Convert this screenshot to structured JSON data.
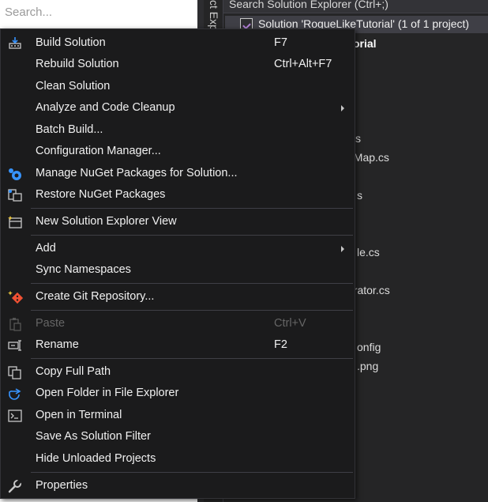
{
  "left_panel": {
    "search_placeholder": "Search..."
  },
  "side_tab": {
    "label": "ct Exp"
  },
  "solution_explorer": {
    "search_label": "Search Solution Explorer (Ctrl+;)",
    "solution_label": "Solution 'RogueLikeTutorial' (1 of 1 project)",
    "items": [
      "orial",
      "s",
      "nMap.cs",
      "s",
      "le.cs",
      "erator.cs",
      "onfig",
      ".png"
    ]
  },
  "context_menu": {
    "items": [
      {
        "label": "Build Solution",
        "shortcut": "F7",
        "icon": "build-icon"
      },
      {
        "label": "Rebuild Solution",
        "shortcut": "Ctrl+Alt+F7",
        "icon": ""
      },
      {
        "label": "Clean Solution",
        "shortcut": "",
        "icon": ""
      },
      {
        "label": "Analyze and Code Cleanup",
        "shortcut": "",
        "icon": "",
        "submenu": true
      },
      {
        "label": "Batch Build...",
        "shortcut": "",
        "icon": ""
      },
      {
        "label": "Configuration Manager...",
        "shortcut": "",
        "icon": ""
      },
      {
        "label": "Manage NuGet Packages for Solution...",
        "shortcut": "",
        "icon": "nuget-icon"
      },
      {
        "label": "Restore NuGet Packages",
        "shortcut": "",
        "icon": "restore-packages-icon"
      },
      {
        "label": "New Solution Explorer View",
        "shortcut": "",
        "icon": "new-view-icon"
      },
      {
        "label": "Add",
        "shortcut": "",
        "icon": "",
        "submenu": true
      },
      {
        "label": "Sync Namespaces",
        "shortcut": "",
        "icon": ""
      },
      {
        "label": "Create Git Repository...",
        "shortcut": "",
        "icon": "git-icon"
      },
      {
        "label": "Paste",
        "shortcut": "Ctrl+V",
        "icon": "paste-icon",
        "disabled": true
      },
      {
        "label": "Rename",
        "shortcut": "F2",
        "icon": "rename-icon"
      },
      {
        "label": "Copy Full Path",
        "shortcut": "",
        "icon": "copy-icon"
      },
      {
        "label": "Open Folder in File Explorer",
        "shortcut": "",
        "icon": "open-folder-icon"
      },
      {
        "label": "Open in Terminal",
        "shortcut": "",
        "icon": "terminal-icon"
      },
      {
        "label": "Save As Solution Filter",
        "shortcut": "",
        "icon": ""
      },
      {
        "label": "Hide Unloaded Projects",
        "shortcut": "",
        "icon": ""
      },
      {
        "label": "Properties",
        "shortcut": "",
        "icon": "wrench-icon"
      }
    ]
  },
  "colors": {
    "menu_background": "#1b1b1c",
    "menu_text": "#f1f1f1",
    "disabled_text": "#656565",
    "separator": "#3f3f46",
    "git_orange": "#f05133",
    "accent_blue": "#3794ff"
  }
}
